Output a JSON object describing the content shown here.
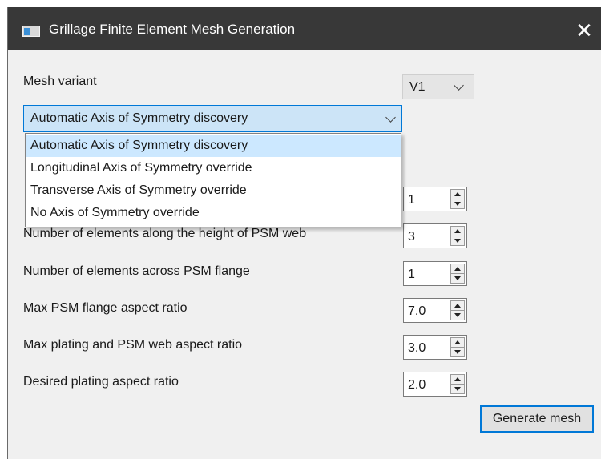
{
  "window": {
    "title": "Grillage Finite Element Mesh Generation"
  },
  "mesh_variant": {
    "label": "Mesh variant",
    "value": "V1"
  },
  "symmetry_combo": {
    "value": "Automatic Axis of Symmetry discovery",
    "options": [
      "Automatic Axis of Symmetry discovery",
      "Longitudinal Axis of Symmetry override",
      "Transverse Axis of Symmetry override",
      "No Axis of Symmetry override"
    ]
  },
  "fields": [
    {
      "label": "",
      "value": "1"
    },
    {
      "label": "Number of elements along the height of PSM web",
      "value": "3"
    },
    {
      "label": "Number of elements across PSM flange",
      "value": "1"
    },
    {
      "label": "Max PSM flange aspect ratio",
      "value": "7.0"
    },
    {
      "label": "Max plating and PSM web aspect ratio",
      "value": "3.0"
    },
    {
      "label": "Desired plating aspect ratio",
      "value": "2.0"
    }
  ],
  "generate_button": "Generate mesh",
  "colors": {
    "titlebar": "#383838",
    "accent": "#0078d7",
    "selection": "#cce8ff"
  }
}
